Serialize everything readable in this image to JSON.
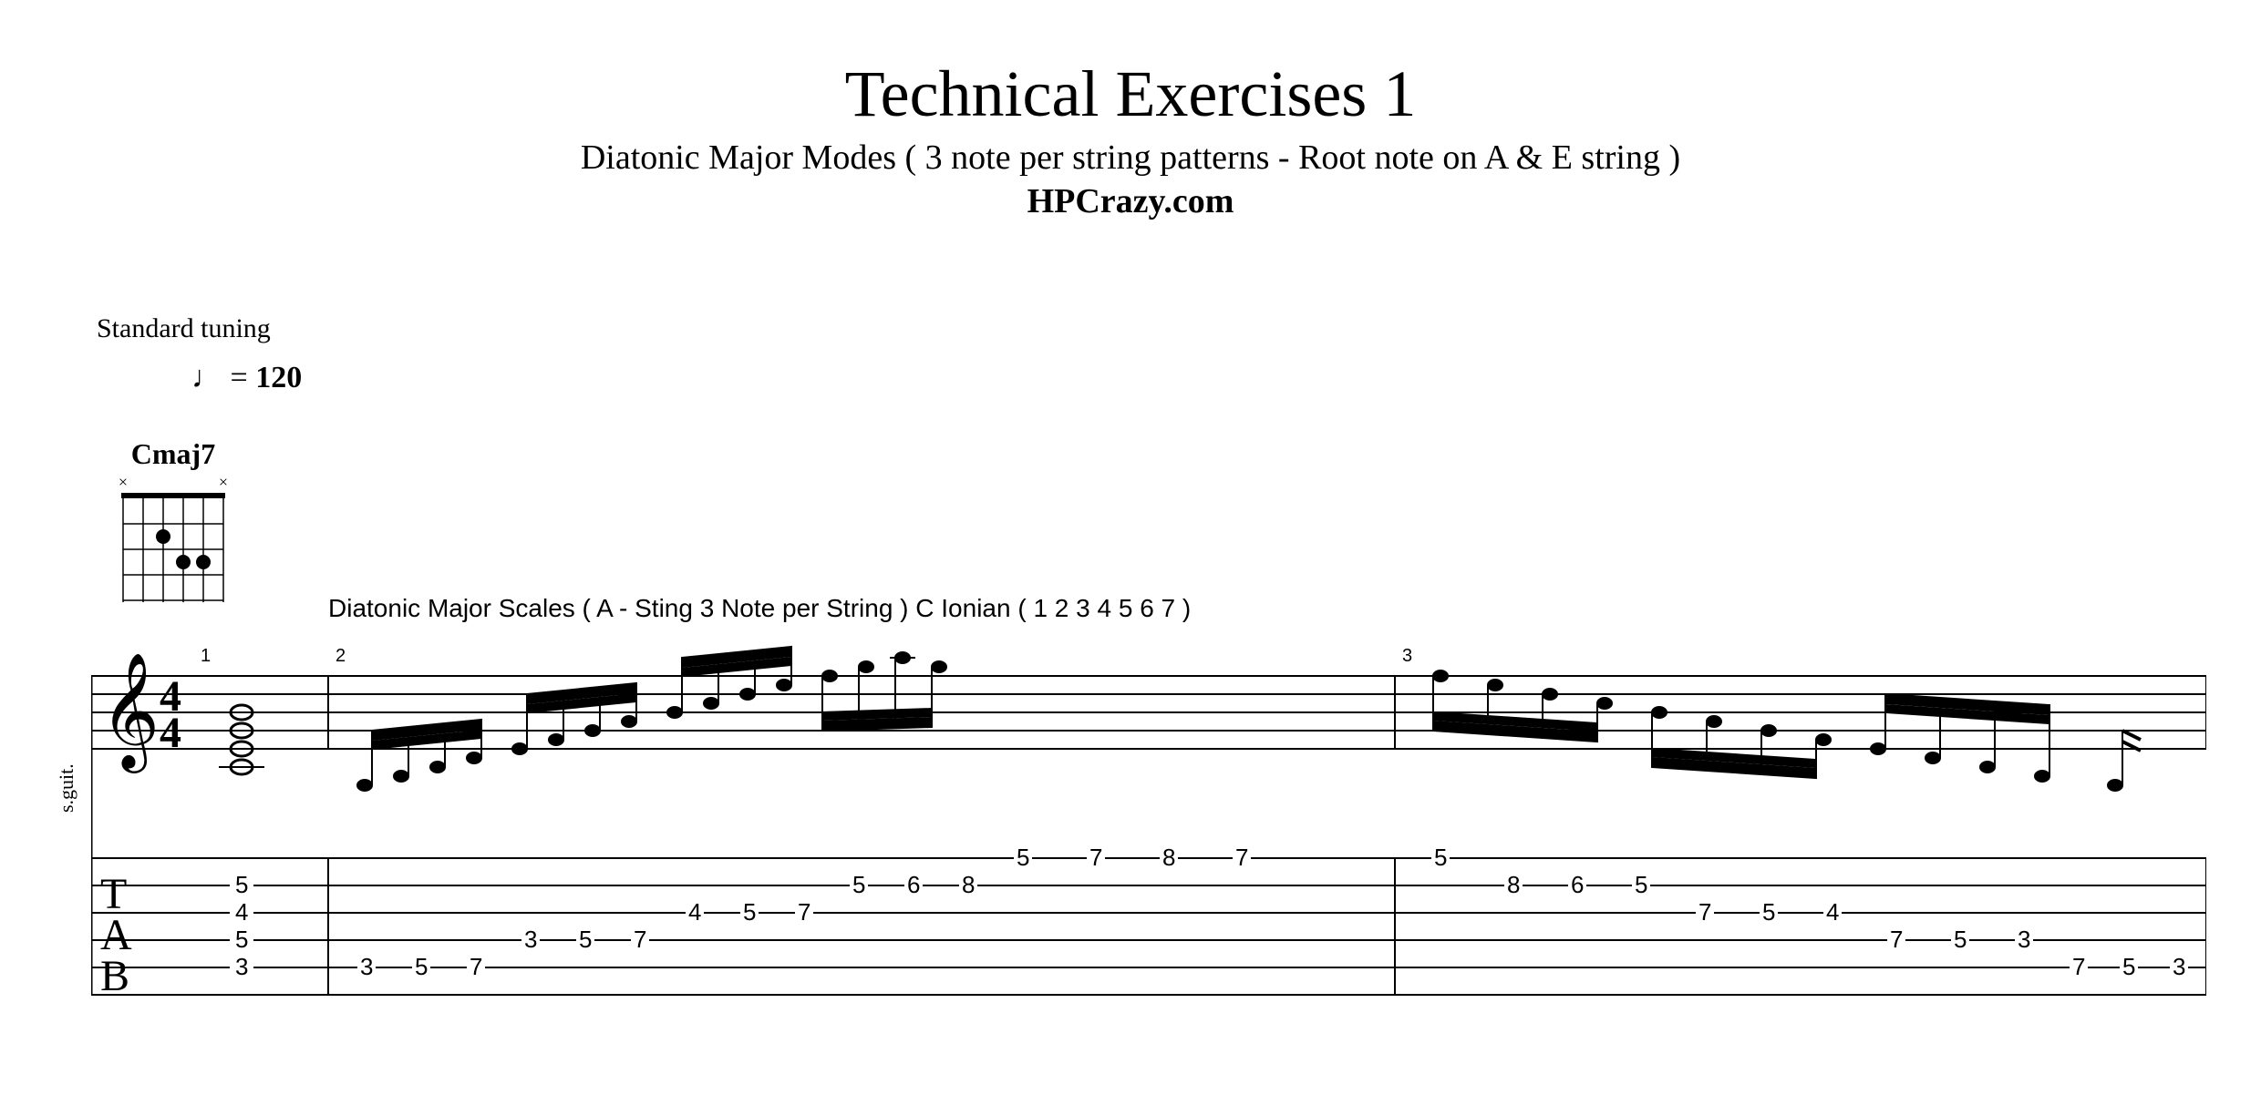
{
  "title": "Technical Exercises 1",
  "subtitle": "Diatonic Major Modes ( 3 note per string patterns - Root note on A & E string )",
  "website": "HPCrazy.com",
  "tuning_label": "Standard tuning",
  "tempo": {
    "symbol": "♩",
    "equals": "=",
    "value": "120"
  },
  "chord": {
    "name": "Cmaj7",
    "nut_marks": [
      "×",
      "",
      "",
      "",
      "",
      "×"
    ],
    "dots": [
      {
        "string": 4,
        "fret": 2
      },
      {
        "string": 3,
        "fret": 3
      },
      {
        "string": 2,
        "fret": 3
      }
    ]
  },
  "annotation": "Diatonic Major Scales ( A - Sting 3 Note per String ) C Ionian ( 1 2 3 4 5 6 7 )",
  "instrument_label": "s.guit.",
  "time_sig": {
    "top": "4",
    "bottom": "4"
  },
  "bar_numbers": [
    "1",
    "2",
    "3"
  ],
  "tab_clef": [
    "T",
    "A",
    "B"
  ],
  "chart_data": {
    "type": "table",
    "title": "Guitar tablature — C Ionian 3-note-per-string",
    "tuning": "Standard",
    "time_signature": "4/4",
    "tempo_bpm": 120,
    "strings_high_to_low": [
      "e",
      "B",
      "G",
      "D",
      "A",
      "E"
    ],
    "measures": [
      {
        "number": 1,
        "chord": "Cmaj7",
        "tab_stack": [
          {
            "string": "e",
            "fret": null
          },
          {
            "string": "B",
            "fret": 5
          },
          {
            "string": "G",
            "fret": 4
          },
          {
            "string": "D",
            "fret": 5
          },
          {
            "string": "A",
            "fret": 3
          },
          {
            "string": "E",
            "fret": null
          }
        ]
      },
      {
        "number": 2,
        "notes_seq": [
          {
            "string": "A",
            "fret": 3
          },
          {
            "string": "A",
            "fret": 5
          },
          {
            "string": "A",
            "fret": 7
          },
          {
            "string": "D",
            "fret": 3
          },
          {
            "string": "D",
            "fret": 5
          },
          {
            "string": "D",
            "fret": 7
          },
          {
            "string": "G",
            "fret": 4
          },
          {
            "string": "G",
            "fret": 5
          },
          {
            "string": "G",
            "fret": 7
          },
          {
            "string": "B",
            "fret": 5
          },
          {
            "string": "B",
            "fret": 6
          },
          {
            "string": "B",
            "fret": 8
          },
          {
            "string": "e",
            "fret": 5
          },
          {
            "string": "e",
            "fret": 7
          },
          {
            "string": "e",
            "fret": 8
          },
          {
            "string": "e",
            "fret": 7
          }
        ]
      },
      {
        "number": 3,
        "notes_seq": [
          {
            "string": "e",
            "fret": 5
          },
          {
            "string": "B",
            "fret": 8
          },
          {
            "string": "B",
            "fret": 6
          },
          {
            "string": "B",
            "fret": 5
          },
          {
            "string": "G",
            "fret": 7
          },
          {
            "string": "G",
            "fret": 5
          },
          {
            "string": "G",
            "fret": 4
          },
          {
            "string": "D",
            "fret": 7
          },
          {
            "string": "D",
            "fret": 5
          },
          {
            "string": "D",
            "fret": 3
          },
          {
            "string": "A",
            "fret": 7
          },
          {
            "string": "A",
            "fret": 5
          },
          {
            "string": "A",
            "fret": 3
          }
        ]
      }
    ]
  }
}
